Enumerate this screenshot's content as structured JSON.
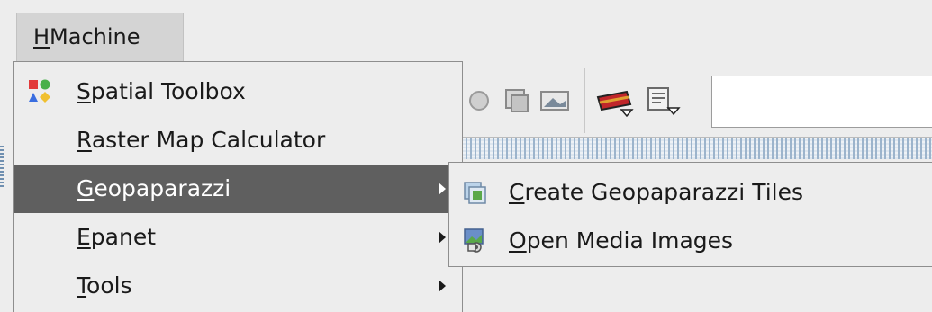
{
  "menubar": {
    "item": {
      "mnemonic": "H",
      "rest": "Machine"
    }
  },
  "menu": {
    "items": [
      {
        "mnemonic": "S",
        "rest": "patial Toolbox",
        "icon": "spatial-toolbox-icon",
        "submenu": false
      },
      {
        "mnemonic": "R",
        "rest": "aster Map Calculator",
        "submenu": false
      },
      {
        "mnemonic": "G",
        "rest": "eopaparazzi",
        "submenu": true,
        "selected": true
      },
      {
        "mnemonic": "E",
        "rest": "panet",
        "submenu": true
      },
      {
        "mnemonic": "T",
        "rest": "ools",
        "submenu": true
      }
    ]
  },
  "submenu": {
    "items": [
      {
        "mnemonic": "C",
        "rest": "reate Geopaparazzi Tiles",
        "icon": "create-tiles-icon"
      },
      {
        "mnemonic": "O",
        "rest": "pen Media Images",
        "icon": "open-media-images-icon"
      }
    ]
  },
  "colors": {
    "selection": "#5f5f5f",
    "menu_bg": "#ededed",
    "menubar_active": "#d4d4d4"
  }
}
